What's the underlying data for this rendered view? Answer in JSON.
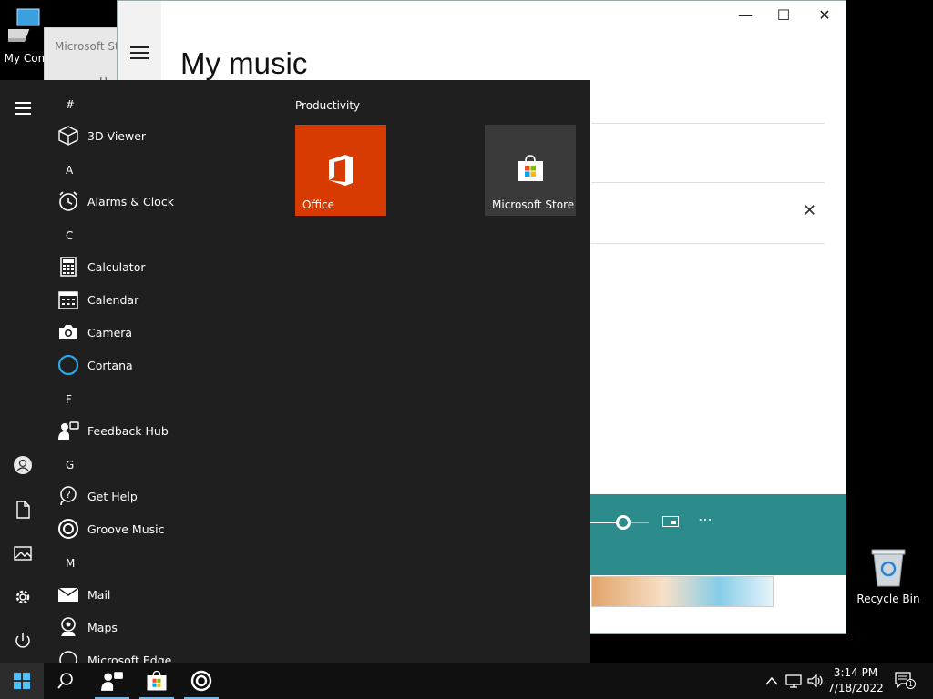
{
  "desktop": {
    "my_computer_label": "My Com",
    "recycle_bin_label": "Recycle Bin"
  },
  "background_window": {
    "title": "Microsoft Sto",
    "nav_text": "H"
  },
  "groove": {
    "page_title": "My music",
    "minimize": "—",
    "maximize": "☐",
    "close": "✕",
    "dismiss": "✕",
    "more": "⋯"
  },
  "start_menu": {
    "letters": [
      "#",
      "A",
      "C",
      "F",
      "G",
      "M"
    ],
    "apps": [
      {
        "label": "3D Viewer"
      },
      {
        "label": "Alarms & Clock"
      },
      {
        "label": "Calculator"
      },
      {
        "label": "Calendar"
      },
      {
        "label": "Camera"
      },
      {
        "label": "Cortana"
      },
      {
        "label": "Feedback Hub"
      },
      {
        "label": "Get Help"
      },
      {
        "label": "Groove Music"
      },
      {
        "label": "Mail"
      },
      {
        "label": "Maps"
      },
      {
        "label": "Microsoft Edge"
      }
    ],
    "group_title": "Productivity",
    "tiles": [
      {
        "label": "Office"
      },
      {
        "label": "Microsoft Store"
      }
    ]
  },
  "taskbar": {
    "time": "3:14 PM",
    "date": "7/18/2022",
    "notification_count": "1"
  },
  "colors": {
    "office_tile": "#d83b01",
    "player_accent": "#2c8c8c",
    "start_bg": "#1f1f1f"
  }
}
